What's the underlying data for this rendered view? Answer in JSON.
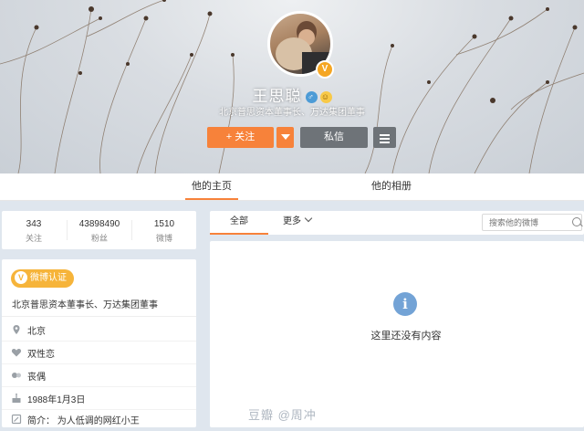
{
  "profile": {
    "name": "王思聪",
    "description": "北京普思资本董事长、万达集团董事",
    "verified_mark": "V",
    "gender_icon": "male-icon",
    "badge_icon": "smile-icon"
  },
  "actions": {
    "follow_label": "+ 关注",
    "message_label": "私信"
  },
  "tabs": {
    "home": "他的主页",
    "album": "他的相册"
  },
  "stats": [
    {
      "value": "343",
      "label": "关注"
    },
    {
      "value": "43898490",
      "label": "粉丝"
    },
    {
      "value": "1510",
      "label": "微博"
    }
  ],
  "info": {
    "verified_badge": "微博认证",
    "verified_text": "北京普思资本董事长、万达集团董事",
    "rows": [
      {
        "icon": "location-icon",
        "text": "北京"
      },
      {
        "icon": "heart-icon",
        "text": "双性恋"
      },
      {
        "icon": "relationship-icon",
        "text": "丧偶"
      },
      {
        "icon": "cake-icon",
        "text": "1988年1月3日"
      },
      {
        "icon": "intro-icon",
        "text": "简介： 为人低调的网红小王"
      }
    ]
  },
  "feed": {
    "tab_all": "全部",
    "tab_more": "更多",
    "search_placeholder": "搜索他的微博",
    "empty_text": "这里还没有内容"
  },
  "watermark": "豆瓣 @周冲",
  "colors": {
    "accent": "#f7823a",
    "dark_button": "#6e7378",
    "verified": "#f6b43a",
    "info_icon": "#73a3d6"
  }
}
